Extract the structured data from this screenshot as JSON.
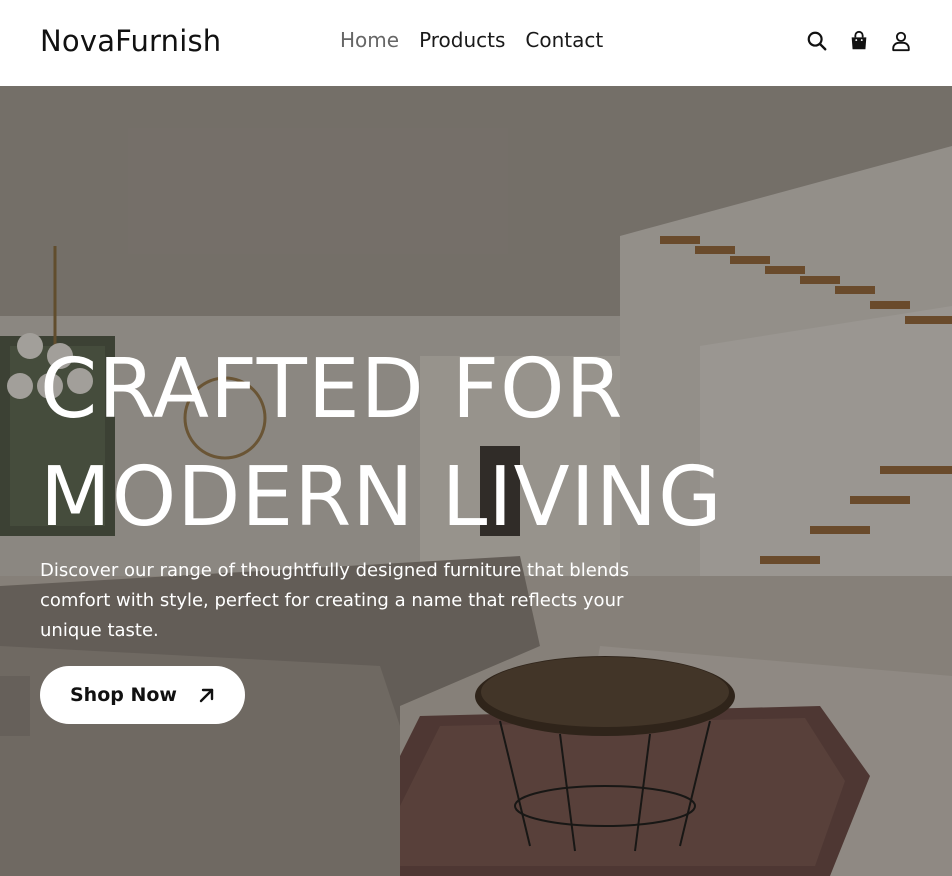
{
  "brand": {
    "name": "NovaFurnish"
  },
  "nav": {
    "items": [
      {
        "label": "Home",
        "active": true
      },
      {
        "label": "Products",
        "active": false
      },
      {
        "label": "Contact",
        "active": false
      }
    ]
  },
  "header_icons": [
    "search-icon",
    "shopping-bag-icon",
    "user-icon"
  ],
  "hero": {
    "headline_line1": "CRAFTED FOR",
    "headline_line2": "MODERN LIVING",
    "description": "Discover our range of thoughtfully designed furniture that blends comfort with style, perfect for creating a name that reflects your unique taste.",
    "cta_label": "Shop Now",
    "cta_icon": "arrow-up-right-icon"
  },
  "colors": {
    "header_bg": "#ffffff",
    "nav_active": "#666666",
    "text_dark": "#111111",
    "hero_text": "#ffffff",
    "cta_bg": "#ffffff"
  }
}
